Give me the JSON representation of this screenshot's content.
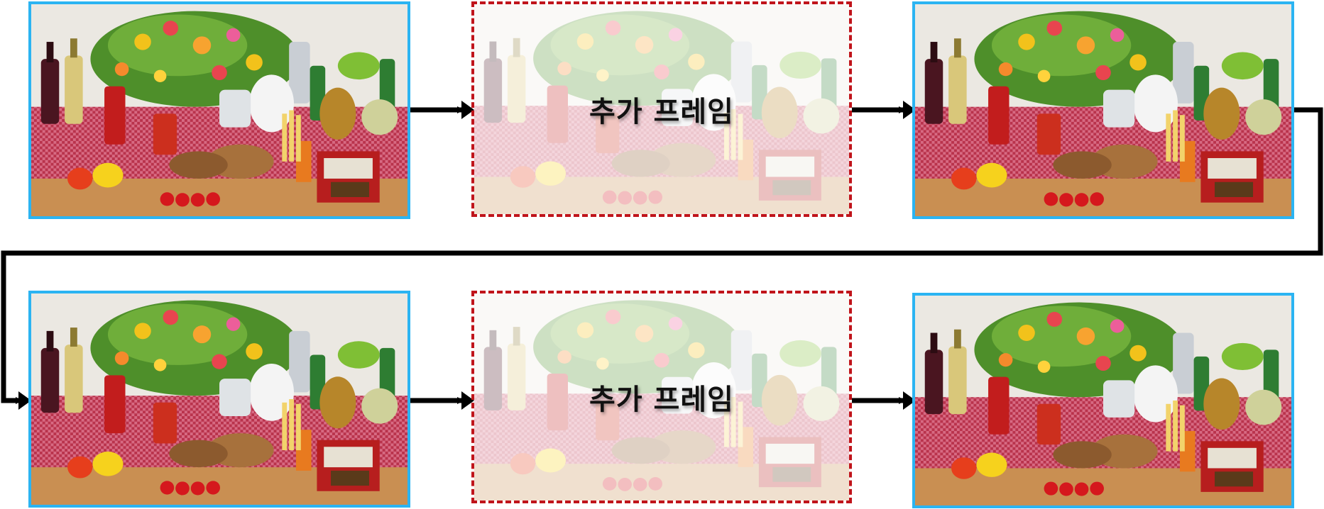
{
  "frames": [
    {
      "kind": "original"
    },
    {
      "kind": "added",
      "label": "추가 프레임"
    },
    {
      "kind": "original"
    },
    {
      "kind": "original"
    },
    {
      "kind": "added",
      "label": "추가 프레임"
    },
    {
      "kind": "original"
    }
  ],
  "colors": {
    "original_border": "#2bb4f2",
    "added_border": "#c0141b",
    "arrow": "#000000"
  }
}
